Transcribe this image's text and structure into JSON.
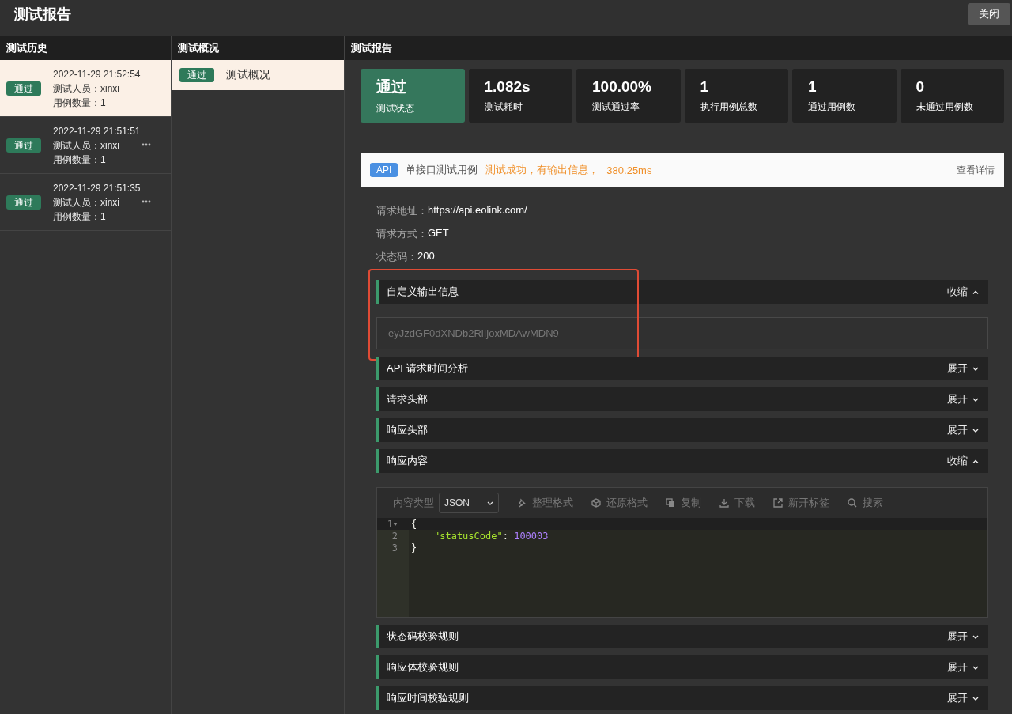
{
  "window": {
    "title": "测试报告",
    "close_button": "关闭"
  },
  "history": {
    "title": "测试历史",
    "items": [
      {
        "status": "通过",
        "time": "2022-11-29 21:52:54",
        "tester": "测试人员：xinxi",
        "cases": "用例数量：1",
        "selected": true
      },
      {
        "status": "通过",
        "time": "2022-11-29 21:51:51",
        "tester": "测试人员：xinxi",
        "cases": "用例数量：1",
        "selected": false
      },
      {
        "status": "通过",
        "time": "2022-11-29 21:51:35",
        "tester": "测试人员：xinxi",
        "cases": "用例数量：1",
        "selected": false
      }
    ]
  },
  "overview": {
    "title": "测试概况",
    "items": [
      {
        "status": "通过",
        "label": "测试概况",
        "selected": true
      }
    ]
  },
  "report": {
    "title": "测试报告",
    "summary": [
      {
        "value": "通过",
        "label": "测试状态",
        "highlighted": true
      },
      {
        "value": "1.082s",
        "label": "测试耗时",
        "highlighted": false
      },
      {
        "value": "100.00%",
        "label": "测试通过率",
        "highlighted": false
      },
      {
        "value": "1",
        "label": "执行用例总数",
        "highlighted": false
      },
      {
        "value": "1",
        "label": "通过用例数",
        "highlighted": false
      },
      {
        "value": "0",
        "label": "未通过用例数",
        "highlighted": false
      }
    ],
    "case": {
      "badge": "API",
      "name": "单接口测试用例",
      "result": "测试成功，有输出信息，",
      "duration": "380.25ms",
      "details_link": "查看详情",
      "info": [
        {
          "label": "请求地址：",
          "value": "https://api.eolink.com/"
        },
        {
          "label": "请求方式：",
          "value": "GET"
        },
        {
          "label": "状态码：",
          "value": "200"
        }
      ],
      "sections": [
        {
          "title": "自定义输出信息",
          "toggle": "收缩",
          "expanded": true,
          "highlighted": true,
          "kind": "output",
          "output": "eyJzdGF0dXNDb2RlIjoxMDAwMDN9"
        },
        {
          "title": "API 请求时间分析",
          "toggle": "展开",
          "expanded": false,
          "highlighted": false
        },
        {
          "title": "请求头部",
          "toggle": "展开",
          "expanded": false,
          "highlighted": false
        },
        {
          "title": "响应头部",
          "toggle": "展开",
          "expanded": false,
          "highlighted": false
        },
        {
          "title": "响应内容",
          "toggle": "收缩",
          "expanded": true,
          "highlighted": false,
          "kind": "editor",
          "editor": {
            "type_label": "内容类型",
            "type_value": "JSON",
            "tools": [
              "整理格式",
              "还原格式",
              "复制",
              "下载",
              "新开标签",
              "搜索"
            ],
            "lines": [
              {
                "number": "1",
                "foldable": true,
                "tokens": [
                  {
                    "kind": "punct",
                    "text": "{"
                  }
                ]
              },
              {
                "number": "2",
                "foldable": false,
                "tokens": [
                  {
                    "kind": "key",
                    "text": "\"statusCode\""
                  },
                  {
                    "kind": "punct",
                    "text": ": "
                  },
                  {
                    "kind": "number",
                    "text": "100003"
                  }
                ]
              },
              {
                "number": "3",
                "foldable": false,
                "tokens": [
                  {
                    "kind": "punct",
                    "text": "}"
                  }
                ]
              }
            ]
          }
        },
        {
          "title": "状态码校验规则",
          "toggle": "展开",
          "expanded": false,
          "highlighted": false
        },
        {
          "title": "响应体校验规则",
          "toggle": "展开",
          "expanded": false,
          "highlighted": false
        },
        {
          "title": "响应时间校验规则",
          "toggle": "展开",
          "expanded": false,
          "highlighted": false
        }
      ]
    }
  }
}
